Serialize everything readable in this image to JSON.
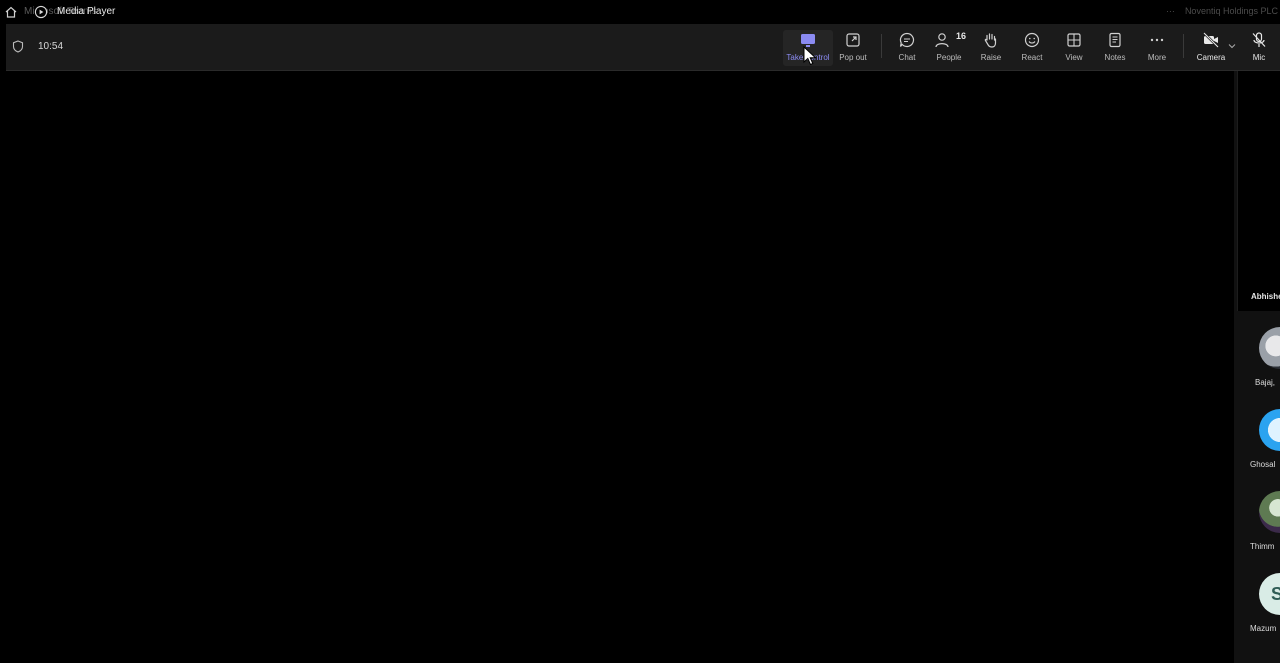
{
  "titlebar": {
    "ghost_title": "Microsoft Teams",
    "app_title": "Media Player",
    "right_dots": "···",
    "right_text": "Noventiq Holdings PLC"
  },
  "toolbar": {
    "timer": "10:54",
    "buttons": {
      "take_control": "Take control",
      "pop_out": "Pop out",
      "chat": "Chat",
      "people": "People",
      "people_count": "16",
      "raise": "Raise",
      "react": "React",
      "view": "View",
      "notes": "Notes",
      "more": "More",
      "camera": "Camera",
      "mic": "Mic"
    }
  },
  "rail": {
    "featured_name": "Abhishek",
    "participants": [
      {
        "name": "Bajaj, ",
        "avatar": "photo1"
      },
      {
        "name": "Ghosal",
        "avatar": "ring"
      },
      {
        "name": "Thimm",
        "avatar": "photo2"
      },
      {
        "name": "Mazum",
        "avatar": "initial",
        "initial": "S"
      }
    ]
  },
  "colors": {
    "accent": "#8b8bf2",
    "toolbar_bg": "#1b1b1b",
    "stage_bg": "#000000"
  },
  "icons": {
    "home": "home-icon",
    "play": "play-icon",
    "shield": "shield-icon",
    "take_control": "take-control-icon",
    "pop_out": "pop-out-icon",
    "chat": "chat-icon",
    "people": "people-icon",
    "raise": "hand-icon",
    "react": "smiley-icon",
    "view": "grid-icon",
    "notes": "notes-icon",
    "more": "ellipsis-icon",
    "camera": "camera-off-icon",
    "mic": "mic-off-icon"
  }
}
